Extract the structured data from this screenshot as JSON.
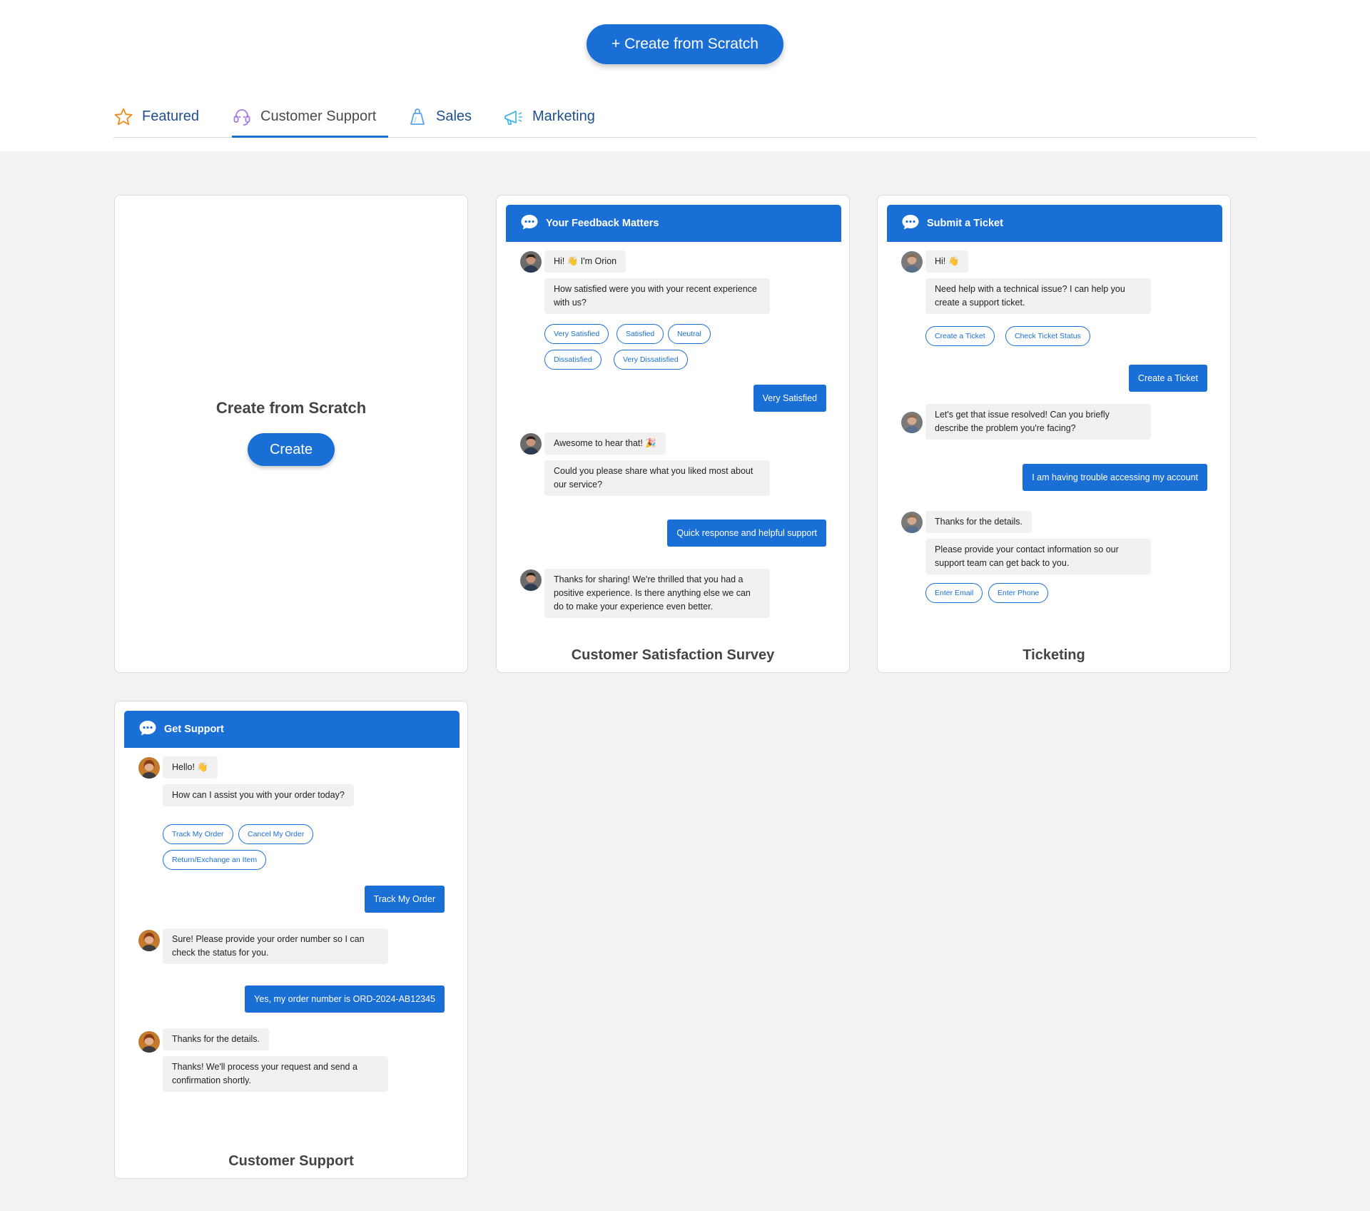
{
  "top": {
    "create_label": "+ Create from Scratch"
  },
  "tabs": [
    {
      "label": "Featured",
      "icon": "star-icon"
    },
    {
      "label": "Customer Support",
      "icon": "headset-icon",
      "active": true
    },
    {
      "label": "Sales",
      "icon": "bag-icon"
    },
    {
      "label": "Marketing",
      "icon": "megaphone-icon"
    }
  ],
  "scratch": {
    "title": "Create from Scratch",
    "button": "Create"
  },
  "survey": {
    "header": "Your Feedback Matters",
    "title": "Customer Satisfaction Survey",
    "m1": "Hi! 👋 I'm Orion",
    "m2": "How satisfied were you with your recent experience with us?",
    "chips": [
      "Very Satisfied",
      "Satisfied",
      "Neutral",
      "Dissatisfied",
      "Very Dissatisfied"
    ],
    "u1": "Very Satisfied",
    "m3": "Awesome to hear that! 🎉",
    "m4": "Could you please share what you liked most about our service?",
    "u2": "Quick response and helpful support",
    "m5": "Thanks for sharing! We're thrilled that you had a positive experience. Is there anything else we can do to make your experience even better."
  },
  "ticket": {
    "header": "Submit a Ticket",
    "title": "Ticketing",
    "m1": "Hi! 👋",
    "m2": "Need help with a technical issue? I can help you create a support ticket.",
    "chips": [
      "Create a Ticket",
      "Check Ticket Status"
    ],
    "u1": "Create a Ticket",
    "m3": "Let's get that issue resolved! Can you briefly describe the problem you're facing?",
    "u2": "I am having trouble accessing my account",
    "m4": "Thanks for the details.",
    "m5": "Please provide your contact information so our support team can get back to you.",
    "chips2": [
      "Enter Email",
      "Enter Phone"
    ]
  },
  "support": {
    "header": "Get Support",
    "title": "Customer Support",
    "m1": "Hello! 👋",
    "m2": "How can I assist you with your order today?",
    "chips": [
      "Track My Order",
      "Cancel My Order",
      "Return/Exchange an Item"
    ],
    "u1": "Track My Order",
    "m3": "Sure! Please provide your order number so I can check the status for you.",
    "u2": "Yes, my order number is ORD-2024-AB12345",
    "m4": "Thanks for the details.",
    "m5": "Thanks! We'll process your request and send a confirmation shortly."
  },
  "colors": {
    "accent": "#1a6fd6",
    "background": "#f2f2f2",
    "bubble": "#f1f1f1"
  }
}
